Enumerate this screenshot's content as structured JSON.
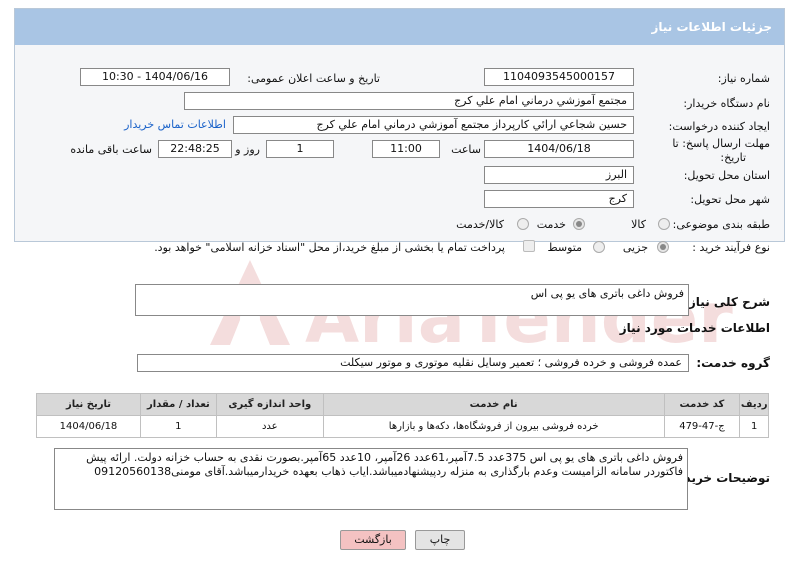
{
  "panel": {
    "title": "جزئیات اطلاعات نیاز"
  },
  "fields": {
    "need_number_label": "شماره نیاز:",
    "need_number": "1104093545000157",
    "announce_label": "تاریخ و ساعت اعلان عمومی:",
    "announce_value": "1404/06/16 - 10:30",
    "buyer_org_label": "نام دستگاه خریدار:",
    "buyer_org": "مجتمع آموزشي درماني امام علي كرج",
    "requester_label": "ایجاد کننده درخواست:",
    "requester": "حسين شجاعي ارائي كارپرداز مجتمع آموزشي درماني امام علي كرج",
    "contact_link": "اطلاعات تماس خریدار",
    "deadline_label_1": "مهلت ارسال پاسخ: تا",
    "deadline_label_2": "تاریخ:",
    "deadline_date": "1404/06/18",
    "time_label": "ساعت",
    "deadline_time": "11:00",
    "days_value": "1",
    "days_label": "روز و",
    "remaining_time": "22:48:25",
    "remaining_label": "ساعت باقی مانده",
    "province_label": "استان محل تحویل:",
    "province": "البرز",
    "city_label": "شهر محل تحویل:",
    "city": "کرج",
    "category_label": "طبقه بندی موضوعی:",
    "category_options": [
      "کالا",
      "خدمت",
      "کالا/خدمت"
    ],
    "category_selected": "خدمت",
    "process_label": "نوع فرآیند خرید :",
    "process_options": [
      "جزیی",
      "متوسط"
    ],
    "process_selected": "جزیی",
    "payment_note": "پرداخت تمام یا بخشی از مبلغ خرید،از محل \"اسناد خزانه اسلامی\" خواهد بود."
  },
  "need_desc": {
    "label": "شرح کلی نیاز:",
    "value": "فروش داغی باتری های یو پی اس"
  },
  "services": {
    "section_title": "اطلاعات خدمات مورد نیاز",
    "group_label": "گروه خدمت:",
    "group_value": "عمده فروشی و خرده فروشی ؛ تعمیر وسایل نقلیه موتوری و موتور سیکلت",
    "table": {
      "headers": [
        "ردیف",
        "کد خدمت",
        "نام خدمت",
        "واحد اندازه گیری",
        "تعداد / مقدار",
        "تاریخ نیاز"
      ],
      "rows": [
        [
          "1",
          "ج-47-479",
          "خرده فروشی بیرون از فروشگاه‌ها، دکه‌ها و بازارها",
          "عدد",
          "1",
          "1404/06/18"
        ]
      ]
    }
  },
  "buyer_notes": {
    "label": "توضیحات خریدار:",
    "value": "فروش داغی باتری های یو پی اس 375عدد 7.5آمپر،61عدد 26آمپر، 10عدد 65آمپر.بصورت نقدی به حساب خزانه دولت. ارائه پیش فاکتوردر سامانه الزامیست وعدم بارگذاری به منزله ردپیشنهادمیباشد.ایاب ذهاب بعهده خریدارمیباشد.آقای مومنی09120560138"
  },
  "buttons": {
    "print": "چاپ",
    "back": "بازگشت"
  },
  "colors": {
    "header_bg": "#a9c5e4",
    "link": "#1a62c9",
    "back_btn": "#f4c2c2",
    "print_btn": "#e4e4e4"
  }
}
